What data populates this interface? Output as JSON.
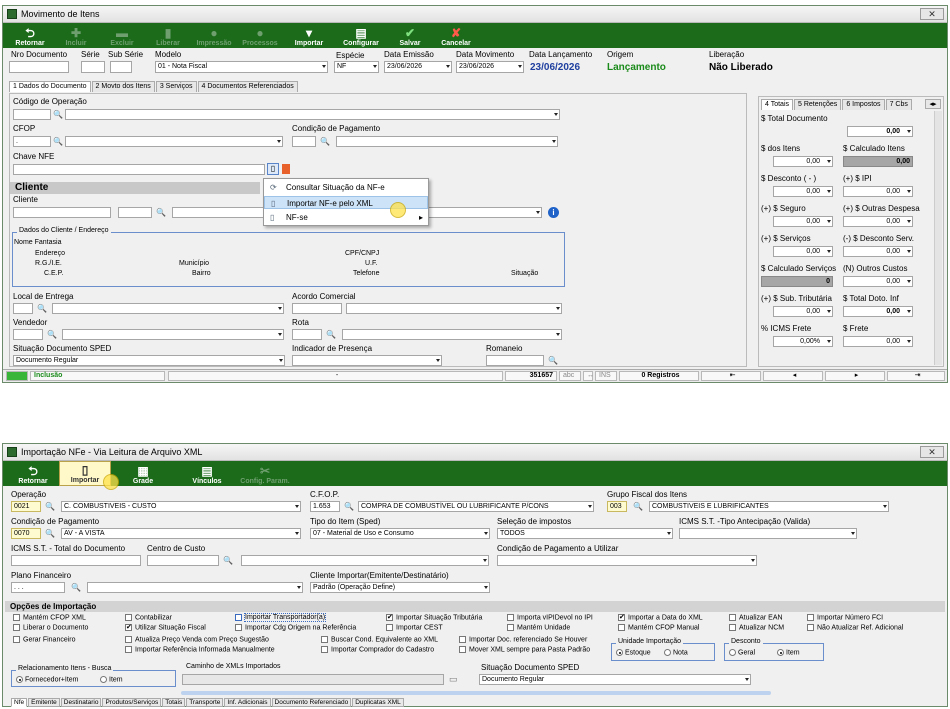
{
  "w1": {
    "title": "Movimento de Itens",
    "close": "✕",
    "toolbar": [
      {
        "label": "Retornar",
        "icon": "⮌",
        "disabled": false
      },
      {
        "label": "Incluir",
        "icon": "✚",
        "disabled": true
      },
      {
        "label": "Excluir",
        "icon": "▬",
        "disabled": true
      },
      {
        "label": "Liberar",
        "icon": "▮",
        "disabled": true
      },
      {
        "label": "Impressão",
        "icon": "●",
        "disabled": true
      },
      {
        "label": "Processos",
        "icon": "●",
        "disabled": true
      },
      {
        "label": "Importar",
        "icon": "▾",
        "disabled": false
      },
      {
        "label": "Configurar",
        "icon": "▤",
        "disabled": false
      },
      {
        "label": "Salvar",
        "icon": "✔",
        "disabled": false
      },
      {
        "label": "Cancelar",
        "icon": "✘",
        "disabled": false
      }
    ],
    "labels": {
      "nro": "Nro Documento",
      "serie": "Série",
      "subserie": "Sub Série",
      "modelo": "Modelo",
      "especie": "Espécie",
      "data_emissao": "Data Emissão",
      "data_movimento": "Data Movimento",
      "data_lancamento": "Data Lançamento",
      "origem": "Origem",
      "liberacao": "Liberação"
    },
    "values": {
      "modelo": "01 - Nota Fiscal",
      "especie": "NF",
      "data_emissao": "23/06/2026",
      "data_movimento": "23/06/2026",
      "data_lancamento": "23/06/2026",
      "origem": "Lançamento",
      "liberacao": "Não Liberado"
    },
    "tabs": [
      "1 Dados do Documento",
      "2 Movto dos Itens",
      "3 Serviços",
      "4 Documentos Referenciados"
    ],
    "form": {
      "cod_operacao": "Código de Operação",
      "cfop": "CFOP",
      "cfop_val": ".",
      "cond_pagamento": "Condição de Pagamento",
      "chave_nfe": "Chave NFE",
      "cliente_header": "Cliente",
      "cliente": "Cliente",
      "dados_cliente": "Dados do Cliente / Endereço",
      "nome_fantasia": "Nome Fantasia",
      "cpf_cnpj": "CPF/CNPJ",
      "endereco": "Endereço",
      "uf": "U.F.",
      "rg_ie": "R.G./I.E.",
      "municipio": "Município",
      "cep": "C.E.P.",
      "bairro": "Bairro",
      "telefone": "Telefone",
      "situacao": "Situação",
      "local_entrega": "Local de Entrega",
      "acordo_comercial": "Acordo Comercial",
      "vendedor": "Vendedor",
      "rota": "Rota",
      "situacao_sped": "Situação Documento SPED",
      "situacao_sped_val": "Documento Regular",
      "indicador_presenca": "Indicador de Presença",
      "romaneio": "Romaneio"
    },
    "menu": [
      "Consultar Situação da NF-e",
      "Importar NF-e pelo XML",
      "NF-se"
    ],
    "right_tabs": [
      "4 Totais",
      "5 Retenções",
      "6 Impostos",
      "7 Cbs"
    ],
    "totals": {
      "total_doc": "$ Total Documento",
      "total_doc_val": "0,00",
      "dos_itens": "$ dos Itens",
      "calc_itens": "$ Calculado Itens",
      "dos_itens_val": "0,00",
      "calc_itens_val": "0,00",
      "desconto": "$ Desconto ( - )",
      "ipi": "(+) $ IPI",
      "desconto_val": "0,00",
      "ipi_val": "0,00",
      "seguro": "(+) $ Seguro",
      "outras": "(+) $ Outras Despesa",
      "seguro_val": "0,00",
      "outras_val": "0,00",
      "servicos": "(+) $ Serviços",
      "desc_serv": "(-) $ Desconto Serv.",
      "servicos_val": "0,00",
      "desc_serv_val": "0,00",
      "calc_servicos": "$ Calculado Serviços",
      "outros_custos": "(N) Outros Custos",
      "calc_servicos_val": "0",
      "outros_custos_val": "0,00",
      "sub_trib": "(+) $ Sub. Tributária",
      "total_doc_inf": "$ Total Doto. Inf",
      "sub_trib_val": "0,00",
      "total_doc_inf_val": "0,00",
      "icms_frete": "% ICMS Frete",
      "frete": "$ Frete",
      "icms_frete_val": "0,00%",
      "frete_val": "0,00"
    },
    "status": {
      "mode": "Inclusão",
      "sep": "-",
      "number": "351657",
      "abc": "abc",
      "ins": "INS",
      "registros": "0 Registros"
    }
  },
  "w2": {
    "title": "Importação NFe - Via Leitura de Arquivo XML",
    "close": "✕",
    "toolbar": [
      {
        "label": "Retornar",
        "icon": "⮌",
        "disabled": false
      },
      {
        "label": "Importar",
        "icon": "▯",
        "disabled": false
      },
      {
        "label": "Grade",
        "icon": "▦",
        "disabled": false
      },
      {
        "label": "Vínculos",
        "icon": "▤",
        "disabled": false
      },
      {
        "label": "Config. Param.",
        "icon": "✂",
        "disabled": true
      }
    ],
    "labels": {
      "operacao": "Operação",
      "cfop": "C.F.O.P.",
      "grupo_fiscal": "Grupo Fiscal dos Itens",
      "cond_pag": "Condição de Pagamento",
      "tipo_item": "Tipo do Item (Sped)",
      "selecao_impostos": "Seleção de impostos",
      "icms_st_tipo": "ICMS S.T. -Tipo Antecipação (Valida)",
      "icms_st_total": "ICMS S.T. - Total do Documento",
      "centro_custo": "Centro de Custo",
      "cond_pag_utilizar": "Condição de Pagamento a Utilizar",
      "plano_fin": "Plano Financeiro",
      "cliente_importar": "Cliente Importar(Emitente/Destinatário)",
      "opcoes": "Opções de Importação",
      "relacionamento": "Relacionamento Itens - Busca",
      "caminho": "Caminho de XMLs Importados",
      "situacao_sped": "Situação Documento SPED",
      "unidade_importacao": "Unidade Importação",
      "desconto": "Desconto"
    },
    "values": {
      "operacao_cod": "0021",
      "operacao": "C. COMBUSTIVEIS - CUSTO",
      "cfop_cod": "1.653",
      "cfop": "COMPRA DE COMBUSTÍVEL OU LUBRIFICANTE P/CONS",
      "grupo_cod": "003",
      "grupo": "COMBUSTIVEIS E LUBRIFICANTES",
      "cond_pag_cod": "0070",
      "cond_pag": "AV - A VISTA",
      "tipo_item": "07 - Material de Uso e Consumo",
      "selecao_impostos": "TODOS",
      "plano_fin": ". . .",
      "cliente_importar": "Padrão (Operação Define)",
      "situacao_sped": "Documento Regular"
    },
    "options": [
      {
        "label": "Mantém CFOP XML",
        "checked": false
      },
      {
        "label": "Liberar o Documento",
        "checked": false
      },
      {
        "label": "Gerar Financeiro",
        "checked": false
      },
      {
        "label": "Contabilizar",
        "checked": false
      },
      {
        "label": "Utilizar Situação Fiscal",
        "checked": true
      },
      {
        "label": "Atualiza Preço Venda com Preço Sugestão",
        "checked": false
      },
      {
        "label": "Importar Referência Informada Manualmente",
        "checked": false
      },
      {
        "label": "Importar Transportador(a)",
        "checked": false
      },
      {
        "label": "Importar Cdg Origem na Referência",
        "checked": false
      },
      {
        "label": "Buscar Cond. Equivalente ao XML",
        "checked": false
      },
      {
        "label": "Importar Comprador do Cadastro",
        "checked": false
      },
      {
        "label": "Importar Situação Tributária",
        "checked": true
      },
      {
        "label": "Importar CEST",
        "checked": false
      },
      {
        "label": "Importa vIPIDevol no IPI",
        "checked": false
      },
      {
        "label": "Mantém Unidade",
        "checked": false
      },
      {
        "label": "Importar Doc. referenciado Se Houver",
        "checked": false
      },
      {
        "label": "Mover XML sempre para Pasta Padrão",
        "checked": false
      },
      {
        "label": "Importar a Data do XML",
        "checked": true
      },
      {
        "label": "Mantém CFOP Manual",
        "checked": false
      },
      {
        "label": "Atualizar EAN",
        "checked": false
      },
      {
        "label": "Atualizar NCM",
        "checked": false
      },
      {
        "label": "Importar Número FCI",
        "checked": false
      },
      {
        "label": "Não Atualizar Ref. Adicional",
        "checked": false
      }
    ],
    "radios": {
      "estoque": "Estoque",
      "nota": "Nota",
      "geral": "Geral",
      "item": "Item",
      "fornecedor_item": "Fornecedor+Item",
      "item2": "Item"
    },
    "bottom_tabs": [
      "Nfe",
      "Emitente",
      "Destinatario",
      "Produtos/Serviços",
      "Totais",
      "Transporte",
      "Inf. Adicionais",
      "Documento Referenciado",
      "Duplicatas XML"
    ]
  }
}
